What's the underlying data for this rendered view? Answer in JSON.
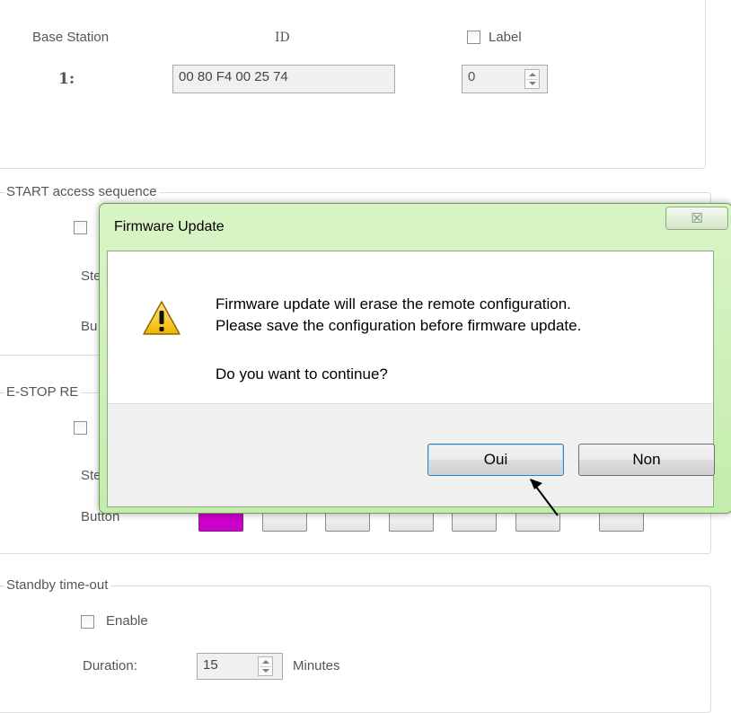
{
  "base_station": {
    "header_label": "Base Station",
    "header_id": "ID",
    "label_checkbox": "Label",
    "row_index": "1:",
    "row_id_value": "00 80 F4 00 25 74",
    "label_spin_value": "0"
  },
  "start_group": {
    "legend": "START access sequence",
    "steps_label": "Ste",
    "button_label": "Bu"
  },
  "estop_group": {
    "legend": "E-STOP RE",
    "steps_label": "Ste",
    "button_label": "Button",
    "selected_color": "#cc00cc"
  },
  "standby_group": {
    "legend": "Standby time-out",
    "enable_label": "Enable",
    "duration_label": "Duration:",
    "duration_value": "15",
    "unit_label": "Minutes"
  },
  "dialog": {
    "title": "Firmware Update",
    "close_glyph": "☒",
    "icon": "warning-icon",
    "message_line1": "Firmware update will erase the remote configuration.",
    "message_line2": "Please save the configuration before firmware update.",
    "question": "Do you want to continue?",
    "yes_label": "Oui",
    "no_label": "Non"
  }
}
